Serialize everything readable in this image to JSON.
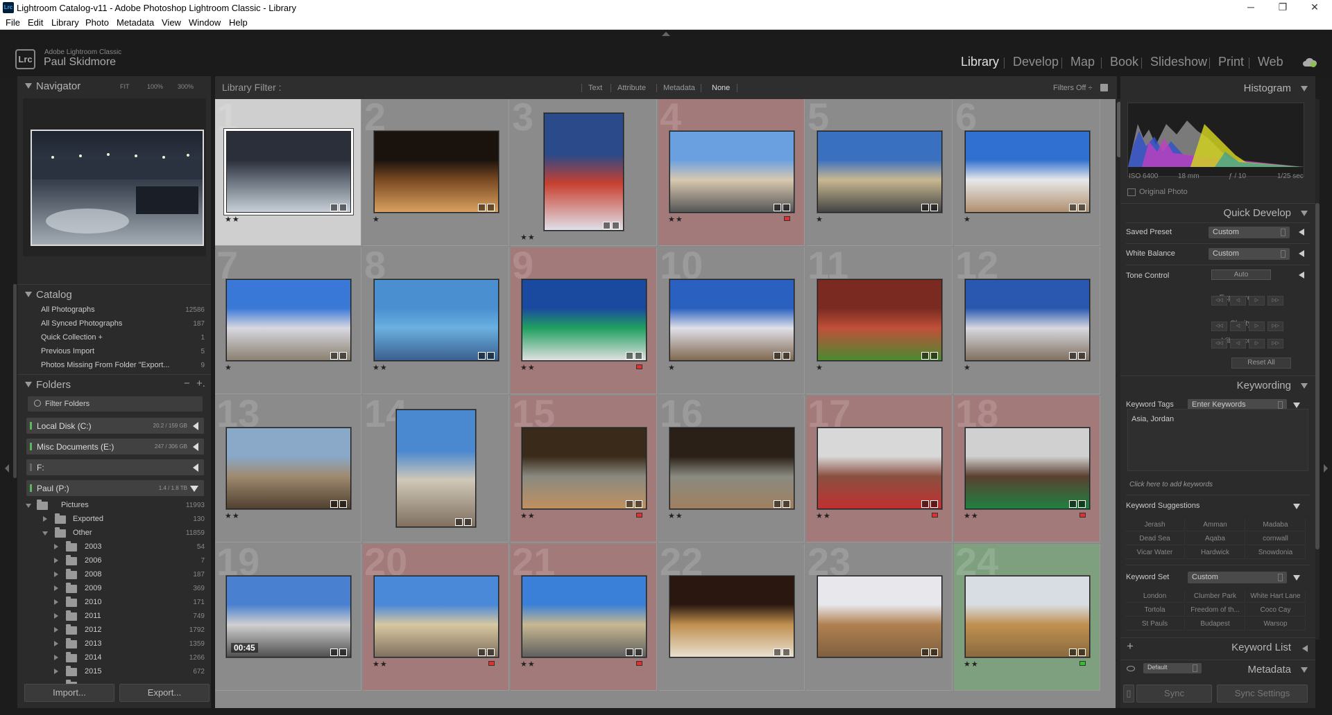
{
  "window": {
    "title": "Lightroom Catalog-v11 - Adobe Photoshop Lightroom Classic - Library",
    "icon": "Lrc"
  },
  "menu": [
    "File",
    "Edit",
    "Library",
    "Photo",
    "Metadata",
    "View",
    "Window",
    "Help"
  ],
  "identity": {
    "product": "Adobe Lightroom Classic",
    "user": "Paul Skidmore",
    "logo": "Lrc"
  },
  "modules": [
    "Library",
    "Develop",
    "Map",
    "Book",
    "Slideshow",
    "Print",
    "Web"
  ],
  "active_module": "Library",
  "navigator": {
    "title": "Navigator",
    "zoom_options": [
      "FIT",
      "100%",
      "300%"
    ]
  },
  "catalog": {
    "title": "Catalog",
    "items": [
      {
        "label": "All Photographs",
        "count": "12586"
      },
      {
        "label": "All Synced Photographs",
        "count": "187"
      },
      {
        "label": "Quick Collection +",
        "count": "1"
      },
      {
        "label": "Previous Import",
        "count": "5"
      },
      {
        "label": "Photos Missing From Folder \"Export...",
        "count": "9"
      }
    ]
  },
  "folders": {
    "title": "Folders",
    "add": "+.",
    "remove": "−",
    "filter_placeholder": "Filter Folders",
    "volumes": [
      {
        "label": "Local Disk (C:)",
        "usage": "20.2 / 159 GB"
      },
      {
        "label": "Misc Documents (E:)",
        "usage": "247 / 306 GB"
      },
      {
        "label": "F:",
        "usage": ""
      },
      {
        "label": "Paul (P:)",
        "usage": "1.4 / 1.8 TB"
      }
    ],
    "tree": [
      {
        "label": "Pictures",
        "count": "11993"
      },
      {
        "label": "Exported",
        "count": "130"
      },
      {
        "label": "Other",
        "count": "11859"
      },
      {
        "label": "2003",
        "count": "54"
      },
      {
        "label": "2006",
        "count": "7"
      },
      {
        "label": "2008",
        "count": "187"
      },
      {
        "label": "2009",
        "count": "369"
      },
      {
        "label": "2010",
        "count": "171"
      },
      {
        "label": "2011",
        "count": "749"
      },
      {
        "label": "2012",
        "count": "1792"
      },
      {
        "label": "2013",
        "count": "1359"
      },
      {
        "label": "2014",
        "count": "1266"
      },
      {
        "label": "2015",
        "count": "672"
      }
    ]
  },
  "left_buttons": {
    "import": "Import...",
    "export": "Export..."
  },
  "library_filter": {
    "title": "Library Filter :",
    "options": [
      "Text",
      "Attribute",
      "Metadata",
      "None"
    ],
    "active": "None",
    "status": "Filters Off ÷"
  },
  "grid": [
    {
      "n": "1",
      "stars": "★★",
      "label": "",
      "bg": "sel",
      "img": [
        "#2a2f3a",
        "#666f7a",
        "#c9d0d8"
      ]
    },
    {
      "n": "2",
      "stars": "★",
      "label": "",
      "bg": "",
      "img": [
        "#1a120c",
        "#7a4a22",
        "#d9a060"
      ]
    },
    {
      "n": "3",
      "stars": "★★",
      "label": "",
      "bg": "",
      "img": [
        "#2a4a8a",
        "#c84030",
        "#e0e0e8"
      ]
    },
    {
      "n": "4",
      "stars": "★★",
      "label": "red",
      "bg": "red",
      "img": [
        "#6aa0e0",
        "#d8c8b0",
        "#555"
      ]
    },
    {
      "n": "5",
      "stars": "★",
      "label": "",
      "bg": "",
      "img": [
        "#3a70c0",
        "#c8b890",
        "#444"
      ]
    },
    {
      "n": "6",
      "stars": "★",
      "label": "",
      "bg": "",
      "img": [
        "#3070d0",
        "#e8e8e8",
        "#b09070"
      ]
    },
    {
      "n": "7",
      "stars": "★",
      "label": "",
      "bg": "",
      "img": [
        "#3a78d8",
        "#d8d8e0",
        "#8a8070"
      ]
    },
    {
      "n": "8",
      "stars": "★★",
      "label": "",
      "bg": "",
      "img": [
        "#4a90d0",
        "#6ab0e0",
        "#3a6090"
      ]
    },
    {
      "n": "9",
      "stars": "★★",
      "label": "red",
      "bg": "red",
      "img": [
        "#1a4aa0",
        "#20a060",
        "#e0e0e0"
      ]
    },
    {
      "n": "10",
      "stars": "★",
      "label": "",
      "bg": "",
      "img": [
        "#2a60c0",
        "#e0e0e8",
        "#806850"
      ]
    },
    {
      "n": "11",
      "stars": "★",
      "label": "",
      "bg": "",
      "img": [
        "#7a2a20",
        "#c0503a",
        "#4a8a30"
      ]
    },
    {
      "n": "12",
      "stars": "★",
      "label": "",
      "bg": "",
      "img": [
        "#2a58b0",
        "#d8d8e0",
        "#807060"
      ]
    },
    {
      "n": "13",
      "stars": "★★",
      "label": "",
      "bg": "",
      "img": [
        "#8aa8c8",
        "#a08a70",
        "#504030"
      ]
    },
    {
      "n": "14",
      "stars": "",
      "label": "",
      "bg": "",
      "img": [
        "#4a88d0",
        "#d0c8b8",
        "#807060"
      ]
    },
    {
      "n": "15",
      "stars": "★★",
      "label": "red",
      "bg": "red",
      "img": [
        "#3a2a1a",
        "#8a8a80",
        "#c09060"
      ]
    },
    {
      "n": "16",
      "stars": "★★",
      "label": "",
      "bg": "",
      "img": [
        "#2a2018",
        "#8a8a80",
        "#a08060"
      ]
    },
    {
      "n": "17",
      "stars": "★★",
      "label": "red",
      "bg": "red",
      "img": [
        "#d8d8d8",
        "#8a5040",
        "#c03030"
      ]
    },
    {
      "n": "18",
      "stars": "★★",
      "label": "red",
      "bg": "red",
      "img": [
        "#d0d0d0",
        "#5a4030",
        "#208040"
      ]
    },
    {
      "n": "19",
      "stars": "",
      "label": "",
      "bg": "",
      "img": [
        "#4a80d0",
        "#d0d0d0",
        "#505050"
      ],
      "video": "00:45"
    },
    {
      "n": "20",
      "stars": "★★",
      "label": "red",
      "bg": "red",
      "img": [
        "#4a88d8",
        "#d8c8a0",
        "#807060"
      ]
    },
    {
      "n": "21",
      "stars": "★★",
      "label": "red",
      "bg": "red",
      "img": [
        "#3a80d8",
        "#c8b890",
        "#606060"
      ]
    },
    {
      "n": "22",
      "stars": "",
      "label": "",
      "bg": "",
      "img": [
        "#2a1810",
        "#c09050",
        "#e8e0d0"
      ]
    },
    {
      "n": "23",
      "stars": "",
      "label": "",
      "bg": "",
      "img": [
        "#e8e8ec",
        "#b08050",
        "#806040"
      ]
    },
    {
      "n": "24",
      "stars": "★★",
      "label": "green",
      "bg": "green",
      "img": [
        "#d8dde4",
        "#c09050",
        "#8a6a40"
      ]
    }
  ],
  "histogram": {
    "title": "Histogram",
    "iso": "ISO 6400",
    "focal": "18 mm",
    "aperture": "ƒ / 10",
    "shutter": "1/25 sec",
    "original_photo": "Original Photo"
  },
  "quick_develop": {
    "title": "Quick Develop",
    "saved_preset": {
      "label": "Saved Preset",
      "value": "Custom"
    },
    "white_balance": {
      "label": "White Balance",
      "value": "Custom"
    },
    "tone_control": {
      "label": "Tone Control",
      "button": "Auto"
    },
    "sliders": [
      "Exposure",
      "Clarity",
      "Vibrance"
    ],
    "reset": "Reset All"
  },
  "keywording": {
    "title": "Keywording",
    "tags_label": "Keyword Tags",
    "tags_mode": "Enter Keywords",
    "keywords": "Asia, Jordan",
    "add_hint": "Click here to add keywords",
    "suggestions_label": "Keyword Suggestions",
    "suggestions": [
      "Jerash",
      "Amman",
      "Madaba",
      "Dead Sea",
      "Aqaba",
      "cornwall",
      "Vicar Water",
      "Hardwick",
      "Snowdonia"
    ],
    "set_label": "Keyword Set",
    "set_value": "Custom",
    "set_keywords": [
      "London",
      "Clumber Park",
      "White Hart Lane",
      "Tortola",
      "Freedom of th...",
      "Coco Cay",
      "St Pauls",
      "Budapest",
      "Warsop"
    ]
  },
  "keyword_list": {
    "title": "Keyword List"
  },
  "metadata": {
    "title": "Metadata",
    "preset": "Default"
  },
  "right_buttons": {
    "sync": "Sync",
    "sync_settings": "Sync Settings"
  },
  "colors": {
    "accent_bg": "#1c1c1c",
    "panel": "#2b2b2b",
    "grid_bg": "#8b8b8b",
    "red_label": "#a37a7a",
    "green_label": "#7fa07f"
  }
}
